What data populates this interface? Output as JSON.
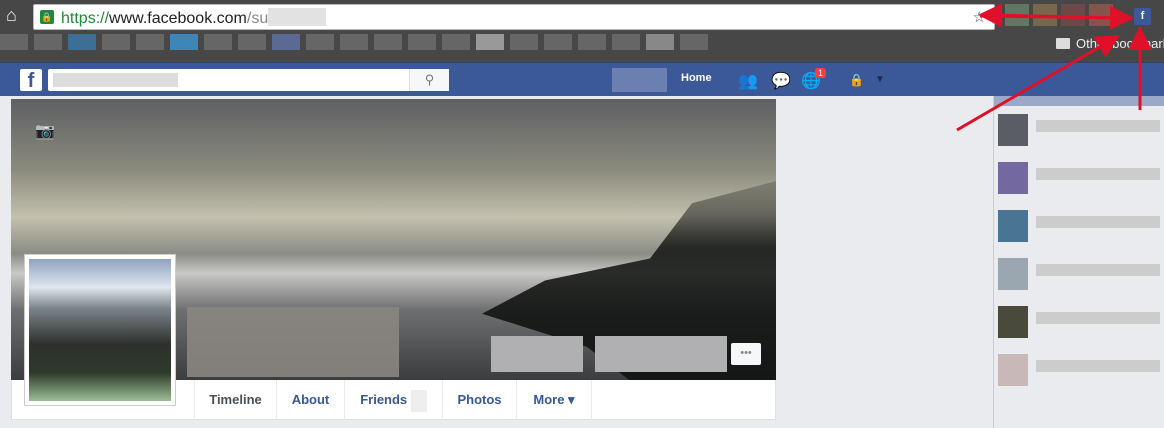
{
  "browser": {
    "url_scheme": "https://",
    "url_host": "www.facebook.com",
    "url_path": "/su",
    "other_bookmarks": "Other bookmarks",
    "extension_label": "f"
  },
  "facebook": {
    "logo": "f",
    "home": "Home",
    "notification_count": "1",
    "more_dots": "•••",
    "tabs": [
      "Timeline",
      "About",
      "Friends",
      "Photos",
      "More ▾"
    ],
    "active_tab": "Timeline"
  },
  "colors": {
    "brand": "#3b5998",
    "annotation_arrow": "#e0102a",
    "badge": "#fa3e3e"
  }
}
